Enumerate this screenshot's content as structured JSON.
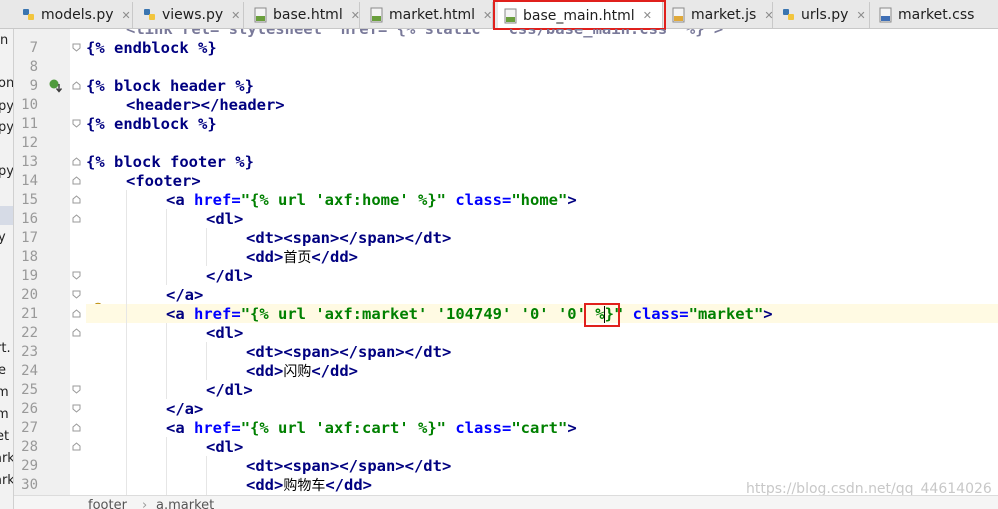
{
  "tabs": [
    {
      "label": "models.py",
      "icon": "python-file-icon"
    },
    {
      "label": "views.py",
      "icon": "python-file-icon"
    },
    {
      "label": "base.html",
      "icon": "html-file-icon"
    },
    {
      "label": "market.html",
      "icon": "html-file-icon"
    },
    {
      "label": "base_main.html",
      "icon": "html-file-icon",
      "active": true
    },
    {
      "label": "market.js",
      "icon": "js-file-icon"
    },
    {
      "label": "urls.py",
      "icon": "python-file-icon"
    },
    {
      "label": "market.css",
      "icon": "css-file-icon"
    }
  ],
  "project_panel_fragments": [
    "n",
    "on",
    "py",
    "py",
    "py",
    "y",
    "rt.",
    "e",
    "m",
    "m",
    "et",
    "ark",
    "ark"
  ],
  "line_numbers": [
    "7",
    "8",
    "9",
    "10",
    "11",
    "12",
    "13",
    "14",
    "15",
    "16",
    "17",
    "18",
    "19",
    "20",
    "21",
    "22",
    "23",
    "24",
    "25",
    "26",
    "27",
    "28",
    "29",
    "30"
  ],
  "code_lines": {
    "l6_partial": "<link rel= stylesheet  href= {% static   css/base_main.css  %} >",
    "l7": "{% endblock %}",
    "l9": "{% block header %}",
    "l10": "<header></header>",
    "l11": "{% endblock %}",
    "l13": "{% block footer %}",
    "l14": "<footer>",
    "l15_tag": "<a",
    "l15_attr": "href=",
    "l15_val": "\"{% url 'axf:home' %}\"",
    "l15_class": "class=",
    "l15_classval": "\"home\"",
    "l16": "<dl>",
    "l17": "<dt><span></span></dt>",
    "l18_open": "<dd>",
    "l18_text": "首页",
    "l18_close": "</dd>",
    "l19": "</dl>",
    "l20": "</a>",
    "l21_tag": "<a",
    "l21_attr": "href=",
    "l21_val_a": "\"{% url 'axf:market' '104749' '0' ",
    "l21_val_b": "'0'",
    "l21_val_c": " %}\"",
    "l21_class": "class=",
    "l21_classval": "\"market\"",
    "l22": "<dl>",
    "l23": "<dt><span></span></dt>",
    "l24_open": "<dd>",
    "l24_text": "闪购",
    "l24_close": "</dd>",
    "l25": "</dl>",
    "l26": "</a>",
    "l27_tag": "<a",
    "l27_attr": "href=",
    "l27_val": "\"{% url 'axf:cart' %}\"",
    "l27_class": "class=",
    "l27_classval": "\"cart\"",
    "l28": "<dl>",
    "l29": "<dt><span></span></dt>",
    "l30_open": "<dd>",
    "l30_text": "购物车",
    "l30_close": "</dd>"
  },
  "breadcrumb": [
    "footer",
    "a.market"
  ],
  "breadcrumb_separator": "›",
  "watermark": "https://blog.csdn.net/qq_44614026",
  "colors": {
    "highlight_box": "#e0201c",
    "tag": "#000080",
    "attr": "#0000ff",
    "string": "#008000",
    "current_line": "#fffae3"
  }
}
